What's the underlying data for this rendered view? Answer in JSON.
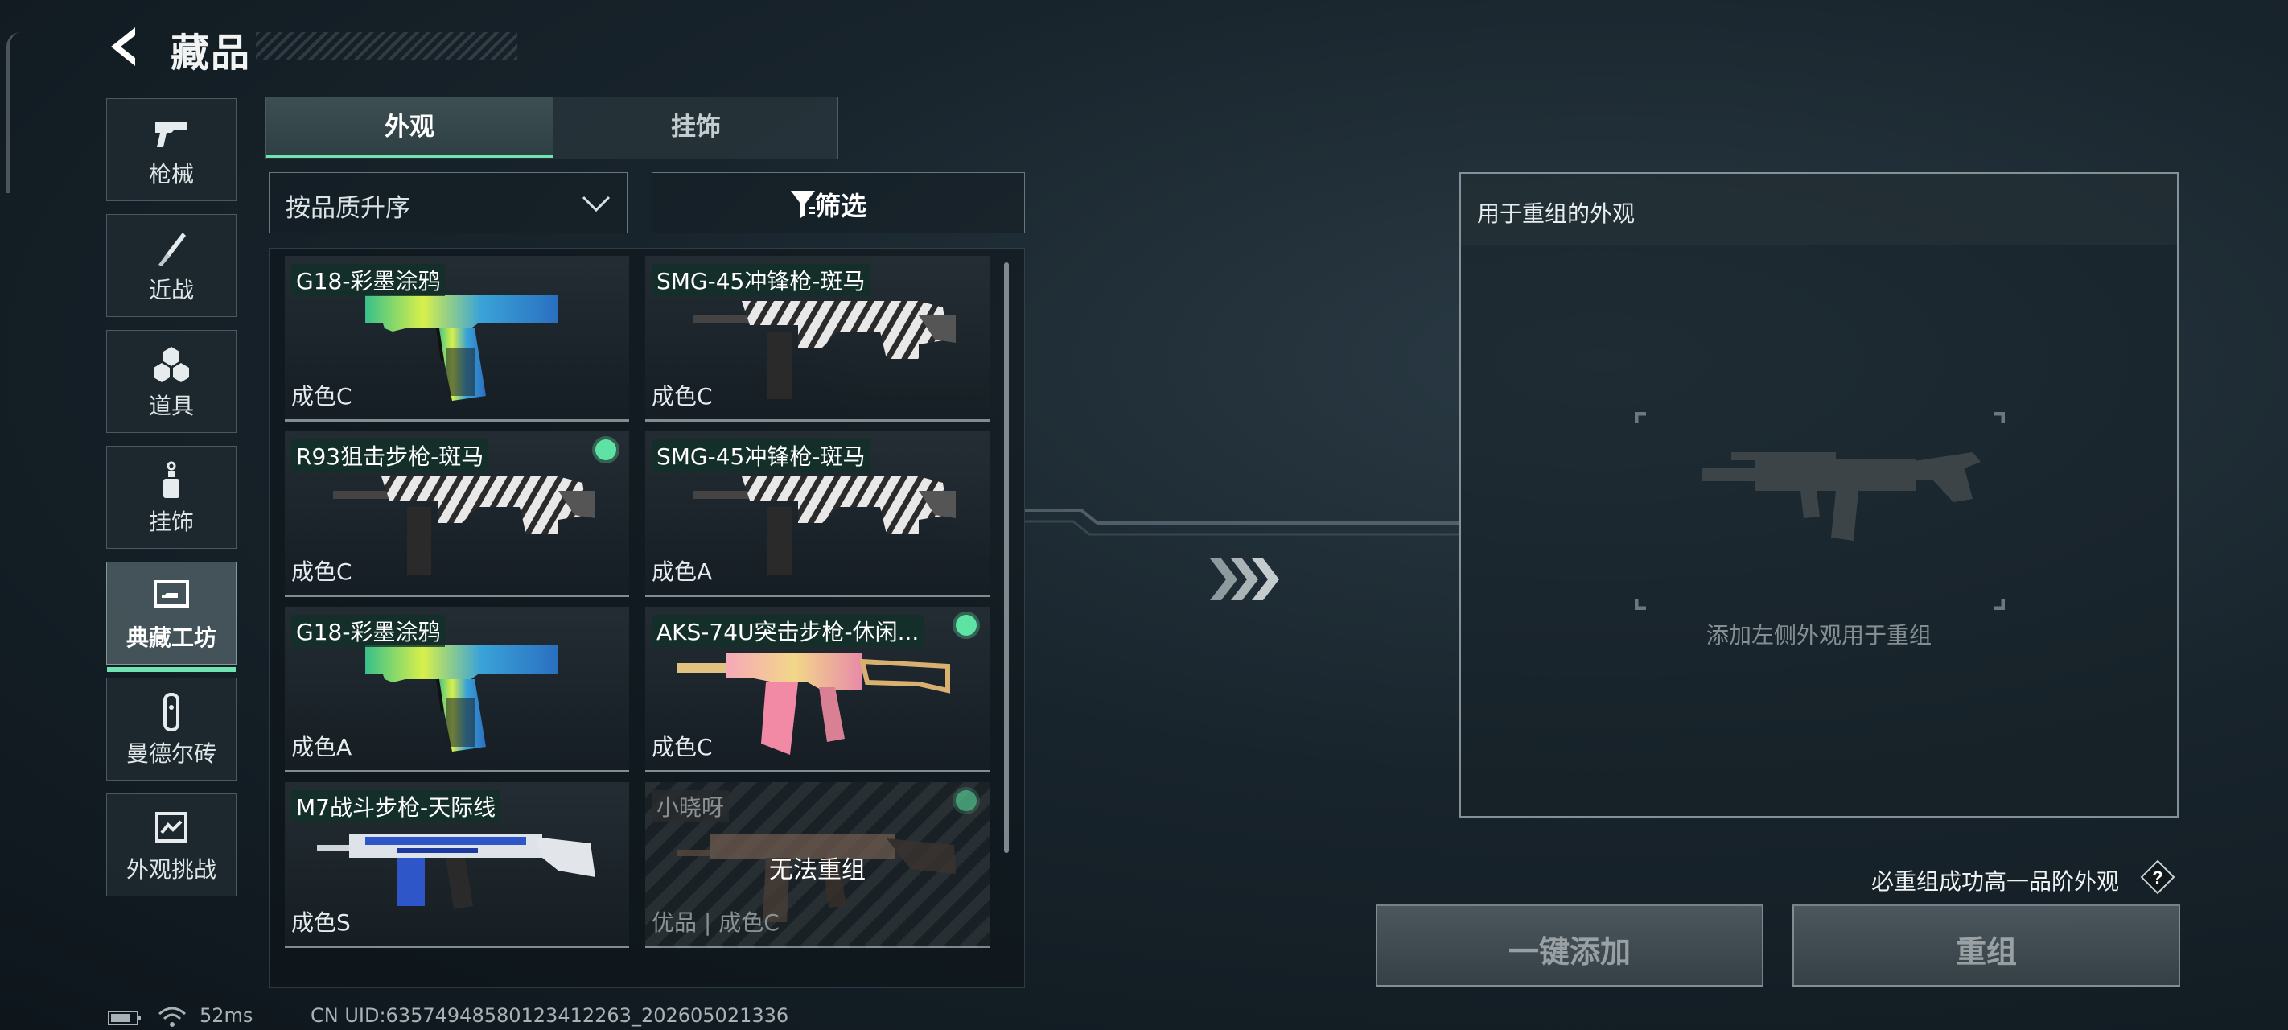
{
  "header": {
    "title": "藏品"
  },
  "sidebar": {
    "items": [
      {
        "label": "枪械",
        "icon": "pistol-icon"
      },
      {
        "label": "近战",
        "icon": "knife-icon"
      },
      {
        "label": "道具",
        "icon": "items-icon"
      },
      {
        "label": "挂饰",
        "icon": "charm-icon"
      },
      {
        "label": "典藏工坊",
        "icon": "workshop-icon",
        "active": true
      },
      {
        "label": "曼德尔砖",
        "icon": "mandel-brick-icon"
      },
      {
        "label": "外观挑战",
        "icon": "appearance-challenge-icon"
      }
    ]
  },
  "tabs": [
    {
      "label": "外观",
      "active": true
    },
    {
      "label": "挂饰",
      "active": false
    }
  ],
  "sort": {
    "label": "按品质升序"
  },
  "filter": {
    "label": "筛选"
  },
  "items": [
    {
      "name": "G18-彩墨涂鸦",
      "condition": "成色C",
      "selected": false,
      "skin": "ink"
    },
    {
      "name": "SMG-45冲锋枪-斑马",
      "condition": "成色C",
      "selected": false,
      "skin": "zebra"
    },
    {
      "name": "R93狙击步枪-斑马",
      "condition": "成色C",
      "selected": true,
      "skin": "zebra"
    },
    {
      "name": "SMG-45冲锋枪-斑马",
      "condition": "成色A",
      "selected": false,
      "skin": "zebra"
    },
    {
      "name": "G18-彩墨涂鸦",
      "condition": "成色A",
      "selected": false,
      "skin": "ink"
    },
    {
      "name": "AKS-74U突击步枪-休闲...",
      "condition": "成色C",
      "selected": true,
      "skin": "pink"
    },
    {
      "name": "M7战斗步枪-天际线",
      "condition": "成色S",
      "selected": false,
      "skin": "blue"
    },
    {
      "name": "小晓呀",
      "condition": "优品 | 成色C",
      "selected": true,
      "disabled": true,
      "overlay": "无法重组",
      "skin": "brown"
    }
  ],
  "panel": {
    "title": "用于重组的外观",
    "hint": "添加左侧外观用于重组"
  },
  "guarantee_text": "必重组成功高一品阶外观",
  "help_label": "?",
  "buttons": {
    "quick_add": "一键添加",
    "recombine": "重组"
  },
  "footer": {
    "ping": "52ms",
    "uid": "CN UID:63574948580123412263_202605021336"
  },
  "colors": {
    "accent": "#6fe3b0",
    "selected_dot": "#5fe3a4"
  }
}
